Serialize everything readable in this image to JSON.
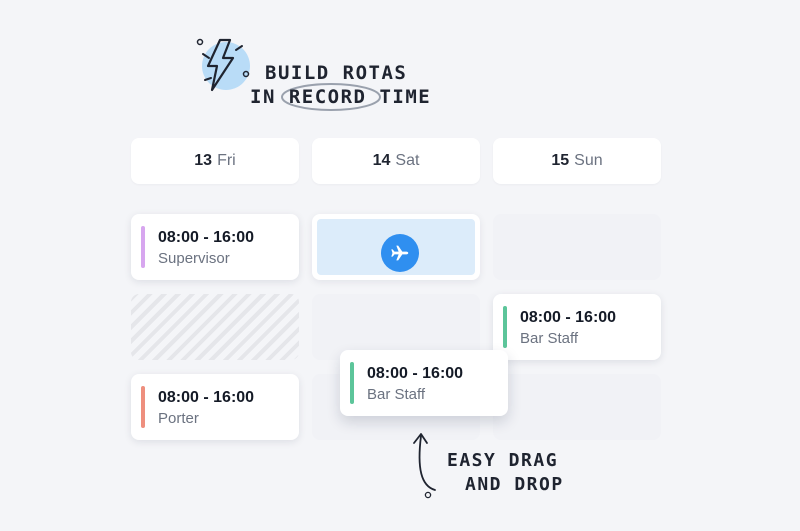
{
  "promo": {
    "line1": "BUILD ROTAS",
    "line2_prefix": "IN",
    "line2_circled": "RECORD",
    "line2_suffix": "TIME",
    "icon": "lightning-bolt-icon"
  },
  "days": [
    {
      "num": "13",
      "dow": "Fri"
    },
    {
      "num": "14",
      "dow": "Sat"
    },
    {
      "num": "15",
      "dow": "Sun"
    }
  ],
  "shifts": {
    "fri_supervisor": {
      "time": "08:00 - 16:00",
      "role": "Supervisor",
      "color": "#d7a6ef"
    },
    "fri_porter": {
      "time": "08:00 - 16:00",
      "role": "Porter",
      "color": "#ee8f7e"
    },
    "sun_bar_staff": {
      "time": "08:00 - 16:00",
      "role": "Bar Staff",
      "color": "#5cc59a"
    },
    "dragging_bar_staff": {
      "time": "08:00 - 16:00",
      "role": "Bar Staff",
      "color": "#5cc59a"
    }
  },
  "leave": {
    "icon": "airplane-icon",
    "color": "#2f8ff0"
  },
  "hint": {
    "line1": "EASY DRAG",
    "line2": "AND DROP"
  }
}
